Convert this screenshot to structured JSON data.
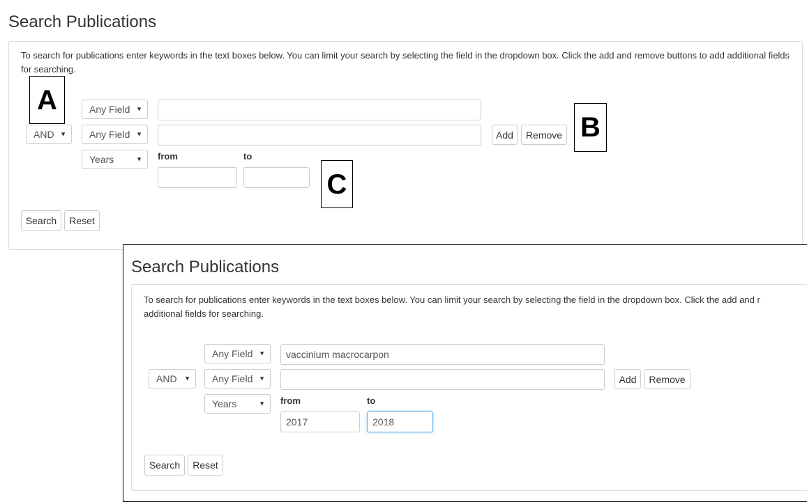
{
  "top": {
    "page_title": "Search Publications",
    "instructions": "To search for publications enter keywords in the text boxes below. You can limit your search by selecting the field in the dropdown box. Click the add and remove buttons to add additional fields for searching.",
    "rows": [
      {
        "operator": "",
        "field": "Any Field",
        "value": ""
      },
      {
        "operator": "AND",
        "field": "Any Field",
        "value": ""
      }
    ],
    "years_field": "Years",
    "from_label": "from",
    "to_label": "to",
    "from_value": "",
    "to_value": "",
    "add_label": "Add",
    "remove_label": "Remove",
    "search_label": "Search",
    "reset_label": "Reset"
  },
  "bottom": {
    "page_title": "Search Publications",
    "instructions_line1": "To search for publications enter keywords in the text boxes below. You can limit your search by selecting the field in the dropdown box. Click the add and r",
    "instructions_line2": "additional fields for searching.",
    "rows": [
      {
        "operator": "",
        "field": "Any Field",
        "value": "vaccinium macrocarpon"
      },
      {
        "operator": "AND",
        "field": "Any Field",
        "value": ""
      }
    ],
    "years_field": "Years",
    "from_label": "from",
    "to_label": "to",
    "from_value": "2017",
    "to_value": "2018",
    "add_label": "Add",
    "remove_label": "Remove",
    "search_label": "Search",
    "reset_label": "Reset"
  },
  "callouts": {
    "a": "A",
    "b": "B",
    "c": "C"
  },
  "icons": {
    "dropdown": "caret-down-icon"
  },
  "colors": {
    "panel_border": "#dddddd",
    "control_border": "#cccccc",
    "focus_border": "#66afe9",
    "text": "#333333"
  }
}
